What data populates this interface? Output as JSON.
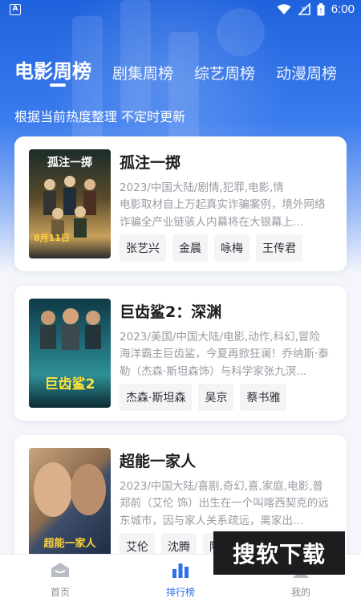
{
  "status_bar": {
    "time": "6:00",
    "left_indicator": "A"
  },
  "tabs": [
    {
      "label": "电影周榜",
      "active": true
    },
    {
      "label": "剧集周榜",
      "active": false
    },
    {
      "label": "综艺周榜",
      "active": false
    },
    {
      "label": "动漫周榜",
      "active": false
    }
  ],
  "subtitle": "根据当前热度整理 不定时更新",
  "movies": [
    {
      "title": "孤注一掷",
      "meta": "2023/中国大陆/剧情,犯罪,电影,情",
      "desc": "电影取材自上万起真实诈骗案例，境外网络诈骗全产业链骇人内幕将在大银幕上...",
      "tags": [
        "张艺兴",
        "金晨",
        "咏梅",
        "王传君"
      ],
      "poster_text": "孤注一掷",
      "poster_date": "8月11日"
    },
    {
      "title": "巨齿鲨2：深渊",
      "meta": "2023/美国/中国大陆/电影,动作,科幻,冒险",
      "desc": "海洋霸主巨齿鲨，今夏再掀狂澜！乔纳斯·泰勒（杰森·斯坦森饰）与科学家张九溟...",
      "tags": [
        "杰森·斯坦森",
        "吴京",
        "蔡书雅"
      ],
      "poster_text": "巨齿鲨2"
    },
    {
      "title": "超能一家人",
      "meta": "2023/中国大陆/喜剧,奇幻,喜,家庭,电影,普",
      "desc": "郑前（艾伦 饰）出生在一个叫喀西契克的远东城市，因与家人关系疏远，离家出...",
      "tags": [
        "艾伦",
        "沈腾",
        "陶"
      ],
      "poster_text": "超能一家人"
    }
  ],
  "bottom_nav": [
    {
      "label": "首页",
      "active": false
    },
    {
      "label": "排行榜",
      "active": true
    },
    {
      "label": "我的",
      "active": false
    }
  ],
  "watermark": "搜软下载",
  "colors": {
    "accent": "#2f6fea",
    "hero": "#1f62dd"
  }
}
